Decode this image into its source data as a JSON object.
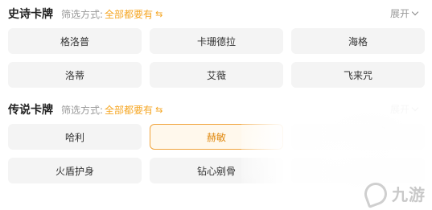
{
  "sections": [
    {
      "title": "史诗卡牌",
      "filter_label": "筛选方式:",
      "filter_value": "全部都要有",
      "swap_icon": "swap-icon",
      "expand_label": "展开",
      "cards": [
        {
          "label": "格洛普"
        },
        {
          "label": "卡珊德拉"
        },
        {
          "label": "海格"
        },
        {
          "label": "洛蒂"
        },
        {
          "label": "艾薇"
        },
        {
          "label": "飞来咒"
        }
      ]
    },
    {
      "title": "传说卡牌",
      "filter_label": "筛选方式:",
      "filter_value": "全部都要有",
      "swap_icon": "swap-icon",
      "expand_label": "展开",
      "cards": [
        {
          "label": "哈利"
        },
        {
          "label": "赫敏",
          "selected": true
        },
        {
          "label": ""
        },
        {
          "label": "火盾护身"
        },
        {
          "label": "钻心剜骨"
        },
        {
          "label": ""
        }
      ]
    }
  ],
  "watermark": {
    "text": "九游"
  },
  "colors": {
    "accent": "#f5a623",
    "card_bg": "#f4f4f4",
    "selected_border": "#f0a33a"
  }
}
